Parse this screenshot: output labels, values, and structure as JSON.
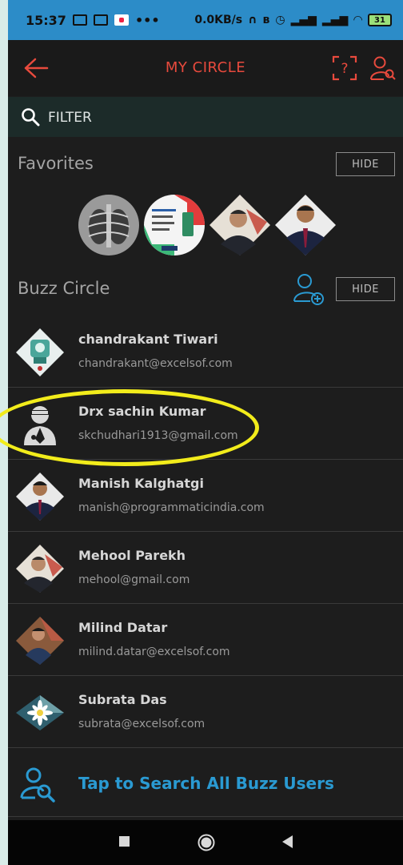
{
  "status_bar": {
    "time": "15:37",
    "dots": "•••",
    "net_speed": "0.0KB/s",
    "battery": "31"
  },
  "header": {
    "title": "MY CIRCLE"
  },
  "filter": {
    "placeholder": "FILTER"
  },
  "favorites": {
    "title": "Favorites",
    "hide_label": "HIDE"
  },
  "buzz_circle": {
    "title": "Buzz Circle",
    "hide_label": "HIDE",
    "contacts": [
      {
        "name": "chandrakant Tiwari",
        "email": "chandrakant@excelsof.com"
      },
      {
        "name": "Drx sachin Kumar",
        "email": "skchudhari1913@gmail.com"
      },
      {
        "name": "Manish Kalghatgi",
        "email": "manish@programmaticindia.com"
      },
      {
        "name": "Mehool Parekh",
        "email": "mehool@gmail.com"
      },
      {
        "name": "Milind Datar",
        "email": "milind.datar@excelsof.com"
      },
      {
        "name": "Subrata Das",
        "email": "subrata@excelsof.com"
      }
    ]
  },
  "search_all": {
    "label": "Tap to Search All Buzz Users"
  },
  "colors": {
    "accent_red": "#e84a3d",
    "accent_blue": "#2a9ad2",
    "status_bar": "#2c8cc8",
    "highlight": "#f2ec1b"
  }
}
